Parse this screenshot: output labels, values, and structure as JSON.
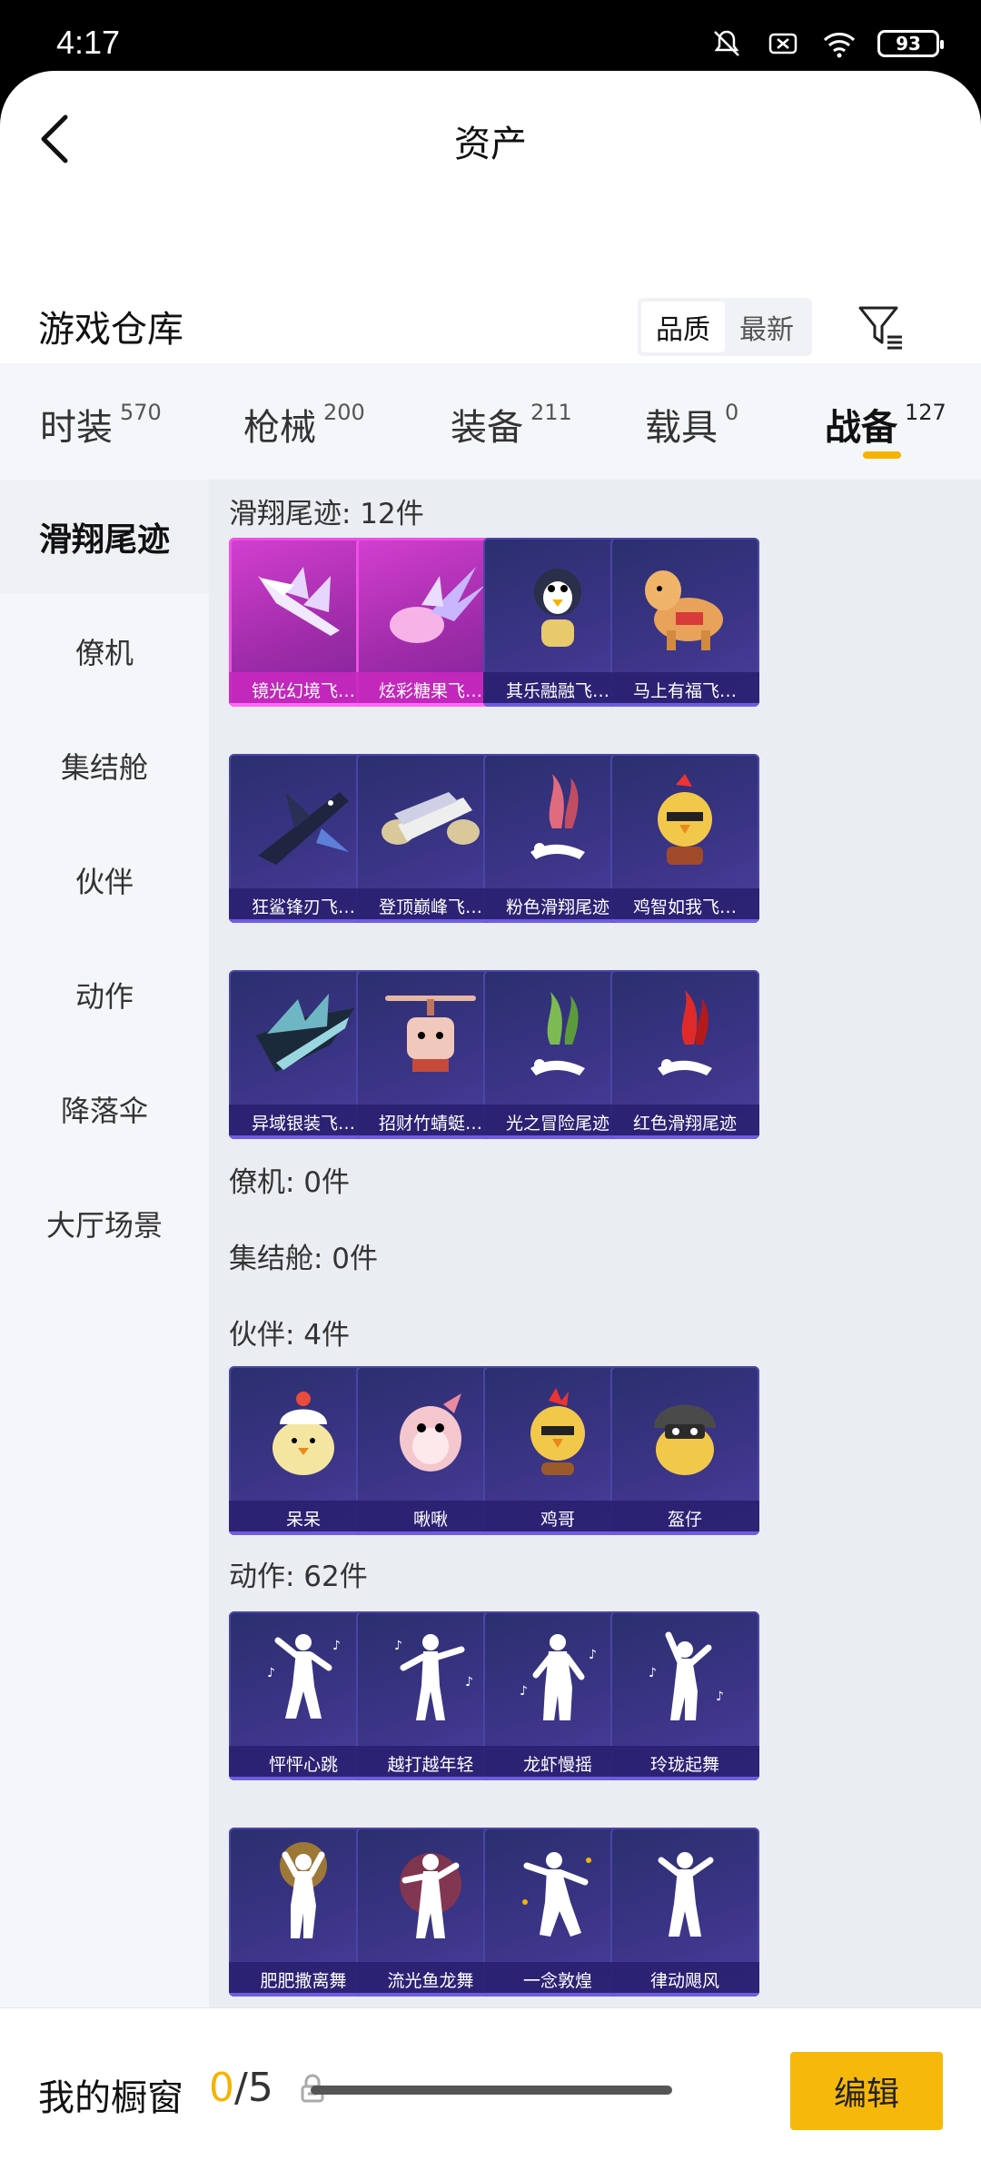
{
  "status_bar": {
    "time": "4:17",
    "battery": "93"
  },
  "header": {
    "title": "资产"
  },
  "warehouse": {
    "title": "游戏仓库",
    "sort_quality": "品质",
    "sort_newest": "最新"
  },
  "tabs": [
    {
      "label": "时装",
      "count": "570"
    },
    {
      "label": "枪械",
      "count": "200"
    },
    {
      "label": "装备",
      "count": "211"
    },
    {
      "label": "载具",
      "count": "0"
    },
    {
      "label": "战备",
      "count": "127"
    }
  ],
  "sidebar": [
    "滑翔尾迹",
    "僚机",
    "集结舱",
    "伙伴",
    "动作",
    "降落伞",
    "大厅场景"
  ],
  "sections": {
    "trails": {
      "label": "滑翔尾迹: 12件",
      "items": [
        "镜光幻境飞…",
        "炫彩糖果飞…",
        "其乐融融飞…",
        "马上有福飞…",
        "狂鲨锋刃飞…",
        "登顶巅峰飞…",
        "粉色滑翔尾迹",
        "鸡智如我飞…",
        "异域银装飞…",
        "招财竹蜻蜓…",
        "光之冒险尾迹",
        "红色滑翔尾迹"
      ]
    },
    "wingman": {
      "label": "僚机: 0件"
    },
    "capsule": {
      "label": "集结舱: 0件"
    },
    "partners": {
      "label": "伙伴: 4件",
      "items": [
        "呆呆",
        "啾啾",
        "鸡哥",
        "盔仔"
      ]
    },
    "actions": {
      "label": "动作: 62件",
      "items": [
        "怦怦心跳",
        "越打越年轻",
        "龙虾慢摇",
        "玲珑起舞",
        "肥肥撒离舞",
        "流光鱼龙舞",
        "一念敦煌",
        "律动飓风"
      ]
    }
  },
  "bottom": {
    "showcase_label": "我的橱窗",
    "showcase_current": "0",
    "showcase_total": "/5",
    "edit_label": "编辑"
  },
  "colors": {
    "accent": "#f5b300",
    "card_purple": "#3b3486",
    "card_pink": "#d43fd0"
  }
}
